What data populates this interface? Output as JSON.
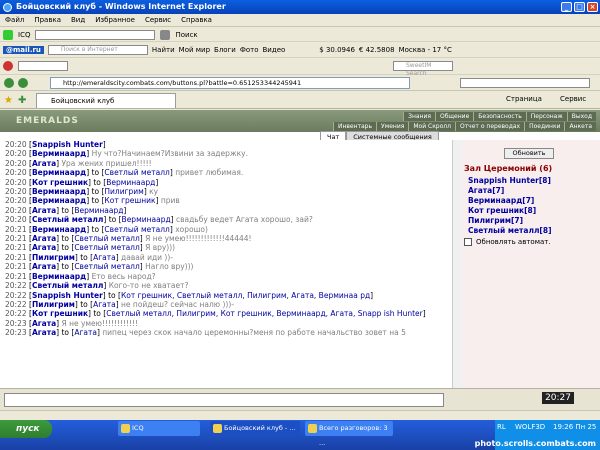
{
  "window": {
    "title": "Бойцовский клуб - Windows Internet Explorer"
  },
  "menu": [
    "Файл",
    "Правка",
    "Вид",
    "Избранное",
    "Сервис",
    "Справка"
  ],
  "toolbar1": {
    "icq": "ICQ",
    "search": "Поиск"
  },
  "toolbar2": {
    "mail": "@mail.ru",
    "search_placeholder": "Поиск в Интернет",
    "find": "Найти",
    "mymir": "Мой мир",
    "blogs": "Блоги",
    "photo": "Фото",
    "video": "Видео",
    "usd": "$ 30.0946",
    "eur": "€ 42.5808",
    "weather": "Москва - 17 °С"
  },
  "toolbar3": {
    "search_placeholder": "SweetIM Search"
  },
  "address": {
    "url": "http://emeraldscity.combats.com/buttons.pl?battle=0.651253344245941"
  },
  "tab": {
    "title": "Бойцовский клуб",
    "page": "Страница",
    "service": "Сервис"
  },
  "game": {
    "logo": "EMERALDS",
    "nav1": [
      "Знания",
      "Общение",
      "Безопасность",
      "Персонаж",
      "Выход"
    ],
    "nav2": [
      "Инвентарь",
      "Умения",
      "Мой Скролл",
      "Отчет о переводах",
      "Поединки",
      "Анкета"
    ],
    "chat_tabs": [
      "Чат",
      "Системные сообщения"
    ],
    "lines": [
      {
        "time": "20:20",
        "from": "Snappish Hunter",
        "text": "",
        "to": ""
      },
      {
        "time": "20:20",
        "from": "Верминаард",
        "text": "Ну что?Начинаем?Извини за задержку.",
        "to": ""
      },
      {
        "time": "20:20",
        "from": "Агата",
        "text": "Ура жених пришел!!!!!",
        "to": ""
      },
      {
        "time": "20:20",
        "from": "Верминаард",
        "text": "привет любимая.",
        "to": "Светлый металл"
      },
      {
        "time": "20:20",
        "from": "Кот грешник",
        "text": "",
        "to": "Верминаард"
      },
      {
        "time": "20:20",
        "from": "Верминаард",
        "text": "ку",
        "to": "Пилигрим"
      },
      {
        "time": "20:20",
        "from": "Верминаард",
        "text": "прив",
        "to": "Кот грешник"
      },
      {
        "time": "20:20",
        "from": "Агата",
        "text": "",
        "to": "Верминаард"
      },
      {
        "time": "20:20",
        "from": "Светлый металл",
        "text": "свадьбу ведет Агата хорошо, зай?",
        "to": "Верминаард"
      },
      {
        "time": "20:21",
        "from": "Верминаард",
        "text": "хорошо)",
        "to": "Светлый металл"
      },
      {
        "time": "20:21",
        "from": "Агата",
        "text": "Я не умею!!!!!!!!!!!!!44444!",
        "to": "Светлый металл"
      },
      {
        "time": "20:21",
        "from": "Агата",
        "text": "Я вру)))",
        "to": "Светлый металл"
      },
      {
        "time": "20:21",
        "from": "Пилигрим",
        "text": "давай иди ))-",
        "to": "Агата"
      },
      {
        "time": "20:21",
        "from": "Агата",
        "text": "Нагло вру)))",
        "to": "Светлый металл"
      },
      {
        "time": "20:21",
        "from": "Верминаард",
        "text": "Ето весь народ?",
        "to": ""
      },
      {
        "time": "20:22",
        "from": "Светлый металл",
        "text": "Кого-то не хватает?",
        "to": ""
      },
      {
        "time": "20:22",
        "from": "Snappish Hunter",
        "text": "",
        "to": "Кот грешник, Светлый металл, Пилигрим, Агата, Верминаа рд"
      },
      {
        "time": "20:22",
        "from": "Пилигрим",
        "text": "не пойдеш? сейчас налю )))-",
        "to": "Агата"
      },
      {
        "time": "20:22",
        "from": "Кот грешник",
        "text": "",
        "to": "Светлый металл, Пилигрим, Кот грешник, Верминаард, Агата, Snapp ish Hunter"
      },
      {
        "time": "20:23",
        "from": "Агата",
        "text": "Я не умею!!!!!!!!!!!!",
        "to": ""
      },
      {
        "time": "20:23",
        "from": "Агата",
        "text": "пипец через скок начало церемонны?меня по работе начальство зовет на 5",
        "to": "Агата"
      }
    ],
    "refresh": "Обновить",
    "room": "Зал Церемоний (6)",
    "users": [
      "Snappish Hunter[8]",
      "Агата[7]",
      "Верминаард[7]",
      "Кот грешник[8]",
      "Пилигрим[7]",
      "Светлый металл[8]"
    ],
    "autoupdate": "Обновлять автомат.",
    "clock": "20:27"
  },
  "taskbar": {
    "start": "пуск",
    "icq": "ICQ",
    "ie": "Бойцовский клуб - ...",
    "chat": "Всего разговоров: 3 ...",
    "lang": "RL",
    "wolf": "WOLF3D",
    "time": "19:26 Пн 25"
  },
  "watermark": "photo.scrolls.combats.com"
}
